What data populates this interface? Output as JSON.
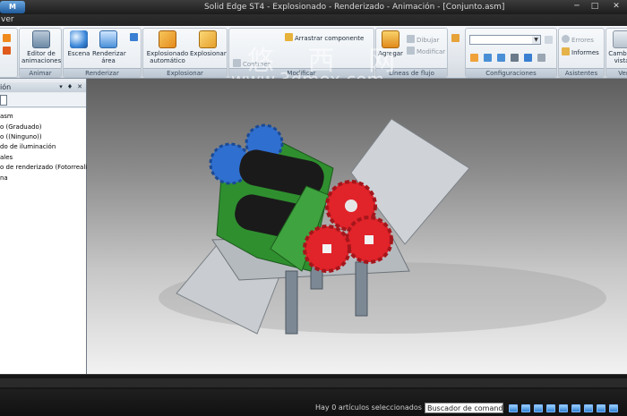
{
  "titlebar": {
    "orb_label": "M",
    "title": "Solid Edge ST4 - Explosionado - Renderizado - Animación - [Conjunto.asm]",
    "min_glyph": "─",
    "max_glyph": "□",
    "close_glyph": "✕"
  },
  "menu": {
    "file_label": "ver"
  },
  "ribbon": {
    "animar": {
      "editor_label": "Editor de animaciones",
      "group_label": "Animar"
    },
    "renderizar": {
      "escena_label": "Escena",
      "area_label": "Renderizar área",
      "group_label": "Renderizar"
    },
    "explosionar": {
      "auto_label": "Explosionado automático",
      "explode_label": "Explosionar",
      "group_label": "Explosionar"
    },
    "modificar": {
      "arrastrar_label": "Arrastrar componente",
      "contraer_label": "Contraer",
      "group_label": "Modificar"
    },
    "lineas": {
      "agregar_label": "Agregar",
      "dibujar_label": "Dibujar",
      "modificar_label": "Modificar",
      "group_label": "Líneas de flujo"
    },
    "config": {
      "combo_value": "",
      "group_label": "Configuraciones"
    },
    "asistentes": {
      "errores_label": "Errores",
      "informes_label": "Informes",
      "group_label": "Asistentes"
    },
    "ver": {
      "cambiar_label": "Cambiar vista",
      "group_label": "Ver"
    }
  },
  "panel": {
    "title": "ión",
    "pin_glyph": "▾",
    "dock_glyph": "♦",
    "close_glyph": "✕"
  },
  "tree": {
    "items": [
      "asm",
      "o (Graduado)",
      "o ((Ninguno))",
      "do de iluminación",
      "ales",
      "o de renderizado (Fotorrealista)",
      "na"
    ]
  },
  "status": {
    "message": "Hay 0 artículos seleccionados",
    "command_finder": "Buscador de comandos"
  },
  "watermark": {
    "cn": "悠 西 网",
    "url": "www.3dmox.com"
  },
  "colors": {
    "gear_red": "#e1232a",
    "gear_blue": "#2f6fd0",
    "frame_green": "#2f8f2f",
    "roller_black": "#1a1a1a",
    "plate_gray": "#c9cdd1"
  }
}
